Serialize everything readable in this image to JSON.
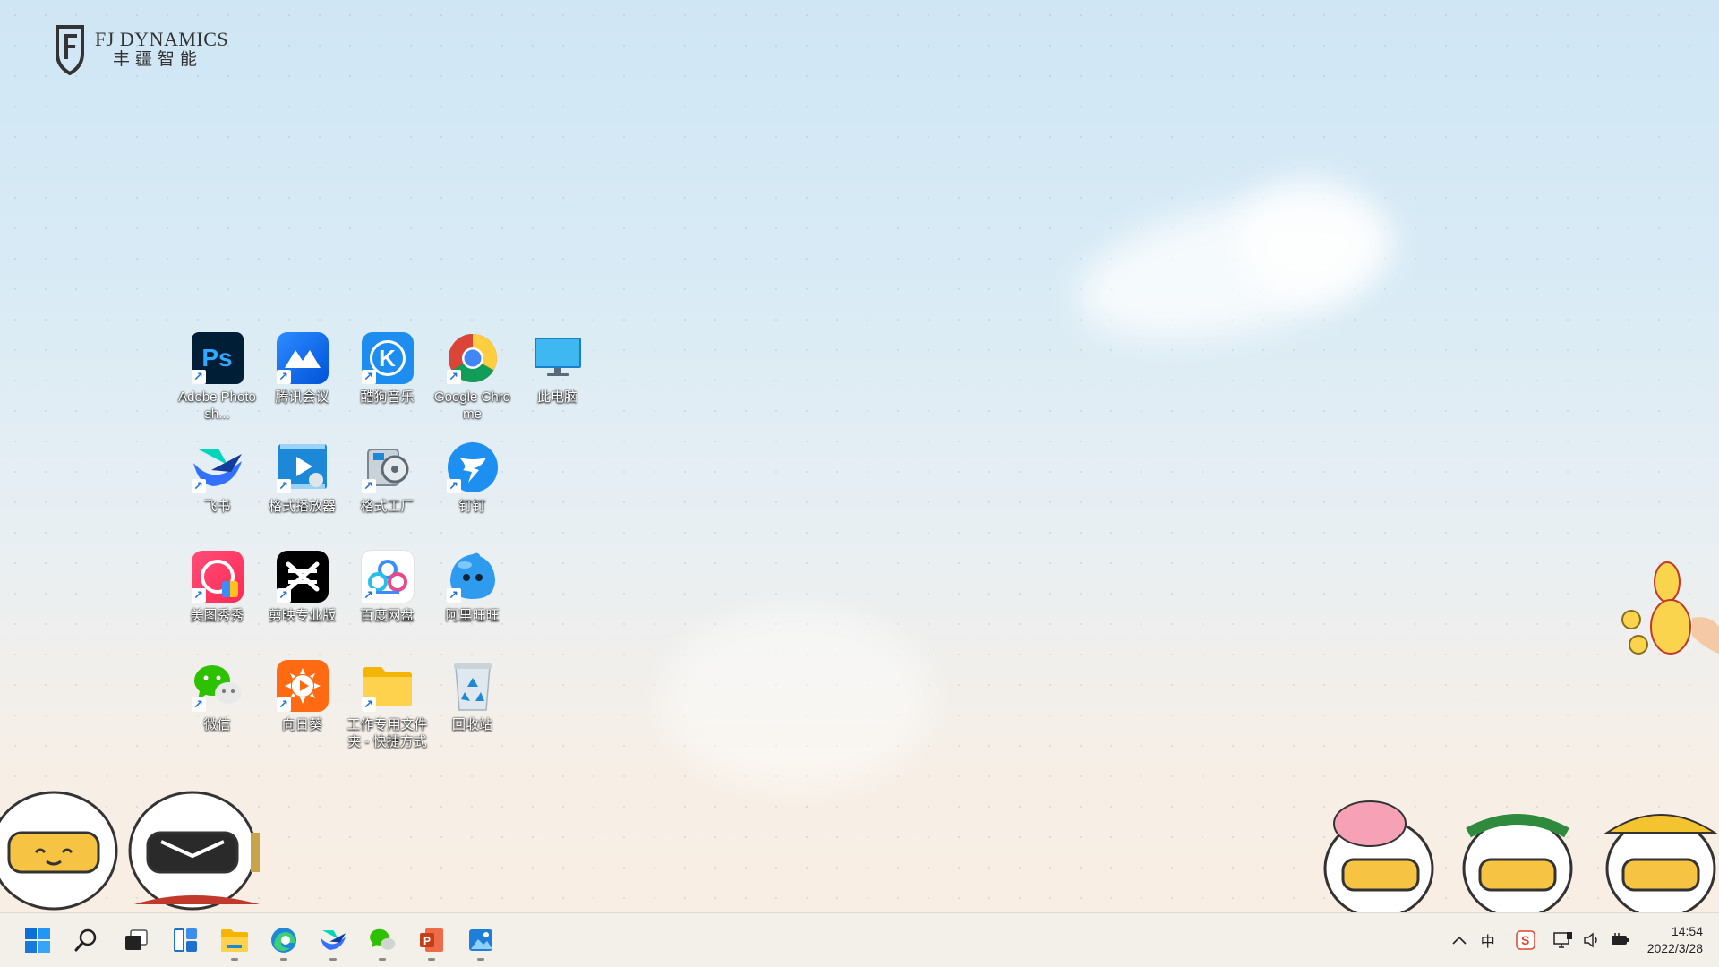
{
  "logo": {
    "line1": "FJ DYNAMICS",
    "line2": "丰疆智能"
  },
  "desktop_icons": [
    {
      "label": "Adobe Photosh...",
      "icon": "photoshop-icon"
    },
    {
      "label": "腾讯会议",
      "icon": "tencent-meeting-icon"
    },
    {
      "label": "酷狗音乐",
      "icon": "kugou-music-icon"
    },
    {
      "label": "Google Chrome",
      "icon": "chrome-icon"
    },
    {
      "label": "此电脑",
      "icon": "this-pc-icon"
    },
    {
      "label": "飞书",
      "icon": "feishu-icon"
    },
    {
      "label": "格式播放器",
      "icon": "format-player-icon"
    },
    {
      "label": "格式工厂",
      "icon": "format-factory-icon"
    },
    {
      "label": "钉钉",
      "icon": "dingtalk-icon"
    },
    {
      "label": "美图秀秀",
      "icon": "meitu-icon"
    },
    {
      "label": "剪映专业版",
      "icon": "capcut-icon"
    },
    {
      "label": "百度网盘",
      "icon": "baidu-netdisk-icon"
    },
    {
      "label": "阿里旺旺",
      "icon": "aliwangwang-icon"
    },
    {
      "label": "微信",
      "icon": "wechat-icon"
    },
    {
      "label": "向日葵",
      "icon": "sunlogin-icon"
    },
    {
      "label": "工作专用文件夹 - 快捷方式",
      "icon": "folder-shortcut-icon"
    },
    {
      "label": "回收站",
      "icon": "recycle-bin-icon"
    }
  ],
  "taskbar": {
    "apps": [
      "windows-start-icon",
      "search-icon",
      "task-view-icon",
      "widgets-icon",
      "file-explorer-icon",
      "edge-icon",
      "feishu-icon",
      "wechat-icon",
      "powerpoint-icon",
      "photos-icon"
    ],
    "tray": {
      "ime": "中",
      "time": "14:54",
      "date": "2022/3/28"
    }
  },
  "colors": {
    "taskbar_bg": "#f3eee9",
    "win_blue": "#0a6fd6"
  }
}
